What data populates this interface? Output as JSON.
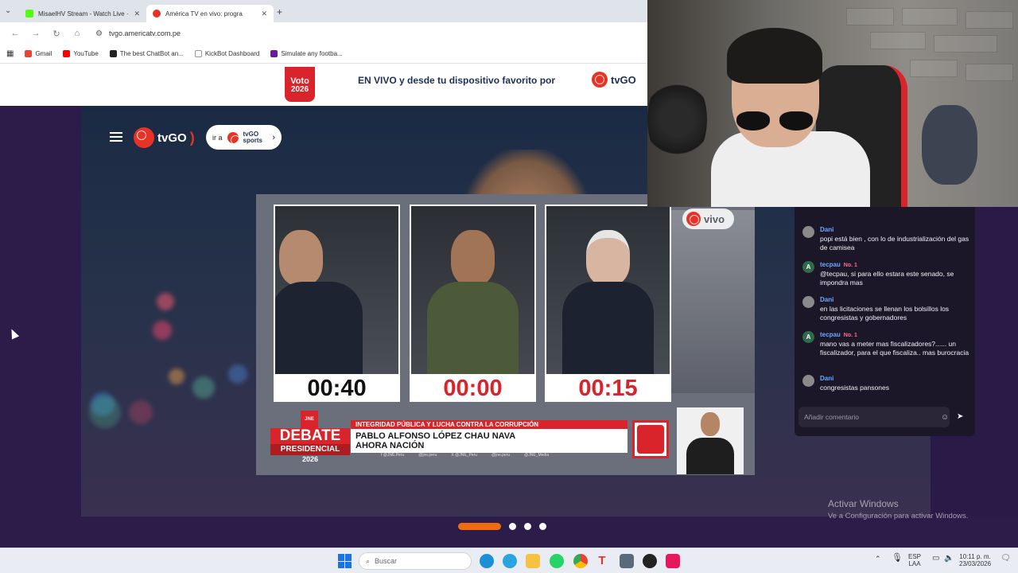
{
  "browser": {
    "tabs": [
      {
        "label": "MisaelHV Stream - Watch Live ·",
        "favicon_color": "#53fc18"
      },
      {
        "label": "América TV en vivo: progra",
        "favicon_color": "#e63326"
      }
    ],
    "new_tab": "+",
    "url": "tvgo.americatv.com.pe",
    "bookmarks": [
      {
        "label": "Gmail",
        "color": "#ea4335"
      },
      {
        "label": "YouTube",
        "color": "#ff0000"
      },
      {
        "label": "The best ChatBot an...",
        "color": "#222222"
      },
      {
        "label": "KickBot Dashboard",
        "color": "#ffffff"
      },
      {
        "label": "Simulate any footba...",
        "color": "#6a1b9a"
      }
    ]
  },
  "banner": {
    "voto_line1": "Voto",
    "voto_line2": "2026",
    "text": "EN VIVO y desde tu dispositivo favorito por",
    "logo": "tvGO"
  },
  "site_header": {
    "logo": "tvGO",
    "ira_prefix": "ir a",
    "ira_brand_1": "tvGO",
    "ira_brand_2": "sports"
  },
  "debate": {
    "live_badge": "vivo",
    "timers": [
      "00:40",
      "00:00",
      "00:15"
    ],
    "timer_colors": [
      "#111111",
      "#d8242a",
      "#d8242a"
    ],
    "logo_top": "JNE",
    "logo_line1": "DEBATE",
    "logo_line2": "PRESIDENCIAL",
    "logo_line3": "2026",
    "topic": "INTEGRIDAD PÚBLICA Y LUCHA CONTRA LA CORRUPCIÓN",
    "candidate_name": "PABLO ALFONSO LÓPEZ CHAU NAVA",
    "party": "AHORA NACIÓN",
    "socials": [
      "f @JNE.Peru",
      "@jne.peru",
      "X @JNE_Peru",
      "@jne.peru",
      "@JNE_Media"
    ]
  },
  "chat": {
    "messages": [
      {
        "avatar": "",
        "user": "Dani",
        "badge": "",
        "text": "popi está bien , con lo de industrialización del gas de camisea"
      },
      {
        "avatar": "A",
        "user": "tecpau",
        "badge": "No. 1",
        "text": "@tecpau, si para ello estara este senado, se impondra mas"
      },
      {
        "avatar": "",
        "user": "Dani",
        "badge": "",
        "text": "en las licitaciones se llenan los bolsillos los congresistas y gobernadores"
      },
      {
        "avatar": "A",
        "user": "tecpau",
        "badge": "No. 1",
        "text": "mano vas a meter mas fiscalizadores?...... un fiscalizador, para el que fiscaliza.. mas burocracia"
      },
      {
        "avatar": "",
        "user": "Dani",
        "badge": "",
        "text": "congresistas pansones"
      }
    ],
    "input_placeholder": "Añadir comentario"
  },
  "carousel": {
    "total": 4,
    "active": 0
  },
  "windows_watermark": {
    "line1": "Activar Windows",
    "line2": "Ve a Configuración para activar Windows."
  },
  "taskbar": {
    "search_placeholder": "Buscar",
    "lang_line1": "ESP",
    "lang_line2": "LAA",
    "time": "10:11 p. m.",
    "date": "23/03/2026"
  }
}
